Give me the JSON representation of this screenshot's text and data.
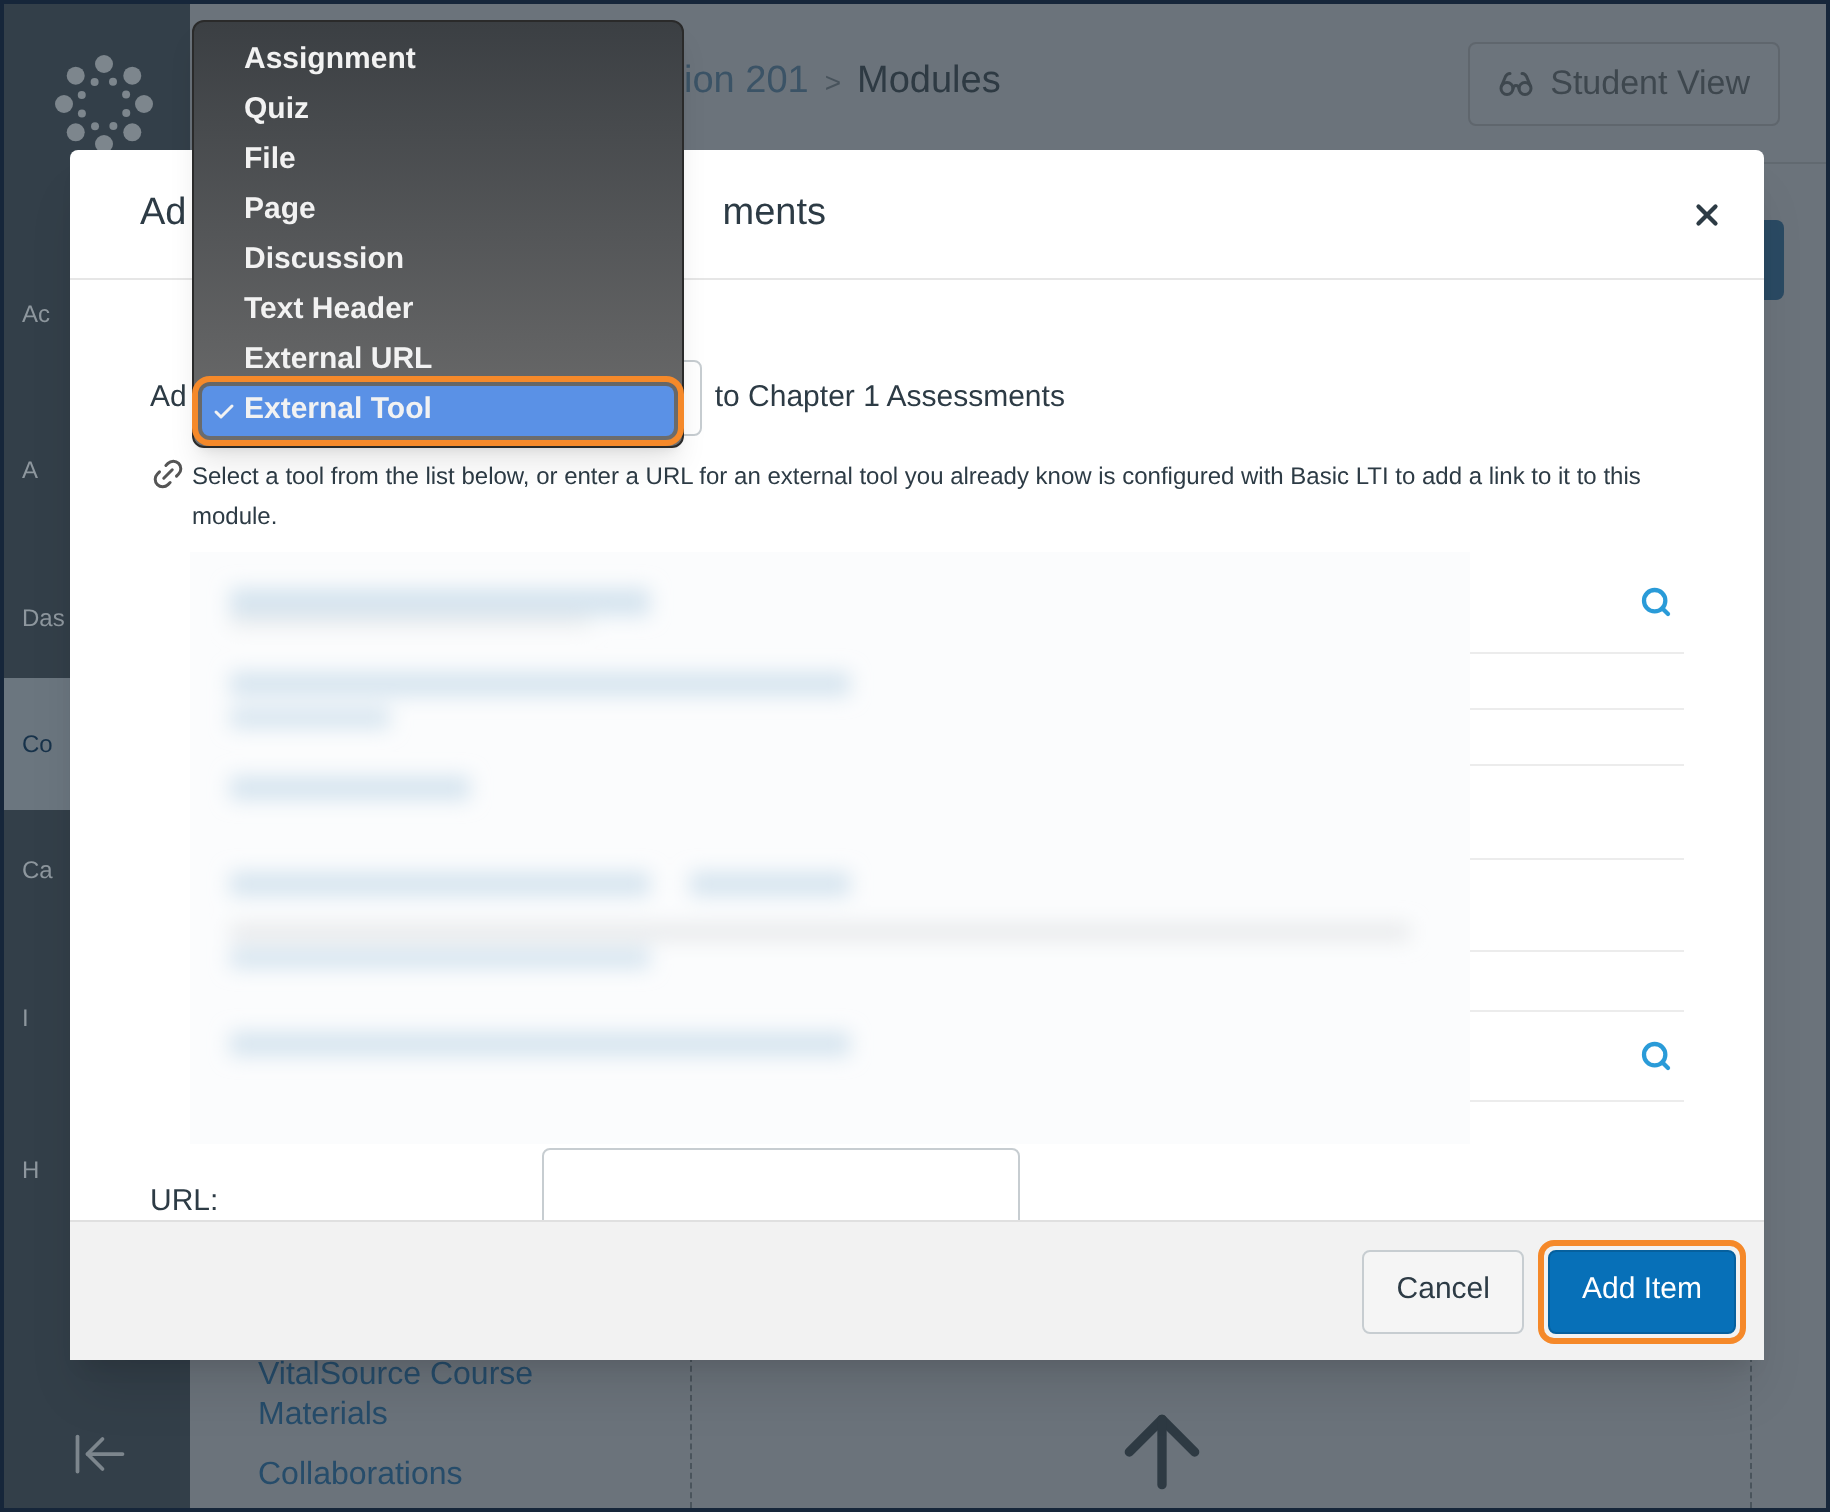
{
  "sidebar": {
    "items": [
      {
        "label": "Ac",
        "selected": false
      },
      {
        "label": "A",
        "selected": false
      },
      {
        "label": "Das",
        "selected": false
      },
      {
        "label": "Co",
        "selected": true
      },
      {
        "label": "Ca",
        "selected": false
      },
      {
        "label": "I",
        "selected": false
      },
      {
        "label": "H",
        "selected": false
      }
    ]
  },
  "breadcrumb": {
    "course": "ion 201",
    "separator": ">",
    "current": "Modules"
  },
  "student_view_button": {
    "label": "Student View"
  },
  "course_nav_links": [
    "VitalSource Course Materials",
    "Collaborations"
  ],
  "modal": {
    "title_start": "Ad",
    "title_end": "ments",
    "add_prefix": "Ad",
    "add_suffix": "to Chapter 1 Assessments",
    "description": "Select a tool from the list below, or enter a URL for an external tool you already know is configured with Basic LTI to add a link to it to this module.",
    "url_label": "URL:",
    "buttons": [
      {
        "label": "Cancel",
        "kind": "secondary",
        "highlighted": false
      },
      {
        "label": "Add Item",
        "kind": "primary",
        "highlighted": true
      }
    ]
  },
  "type_menu": {
    "items": [
      {
        "label": "Assignment",
        "selected": false,
        "highlighted": false
      },
      {
        "label": "Quiz",
        "selected": false,
        "highlighted": false
      },
      {
        "label": "File",
        "selected": false,
        "highlighted": false
      },
      {
        "label": "Page",
        "selected": false,
        "highlighted": false
      },
      {
        "label": "Discussion",
        "selected": false,
        "highlighted": false
      },
      {
        "label": "Text Header",
        "selected": false,
        "highlighted": false
      },
      {
        "label": "External URL",
        "selected": false,
        "highlighted": false
      },
      {
        "label": "External Tool",
        "selected": true,
        "highlighted": true
      }
    ]
  }
}
